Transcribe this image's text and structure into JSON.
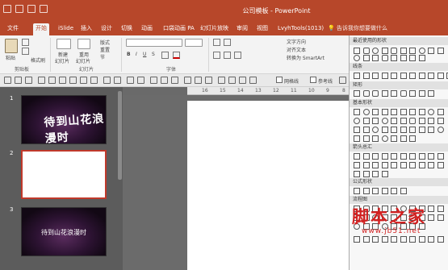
{
  "window": {
    "title": "公司模板 - PowerPoint"
  },
  "tabs": [
    {
      "label": "文件",
      "active": false
    },
    {
      "label": "开始",
      "active": true
    },
    {
      "label": "iSlide",
      "active": false
    },
    {
      "label": "插入",
      "active": false
    },
    {
      "label": "设计",
      "active": false
    },
    {
      "label": "切换",
      "active": false
    },
    {
      "label": "动画",
      "active": false
    },
    {
      "label": "口袋动画 PA",
      "active": false
    },
    {
      "label": "幻灯片放映",
      "active": false
    },
    {
      "label": "审阅",
      "active": false
    },
    {
      "label": "视图",
      "active": false
    },
    {
      "label": "LvyhTools(1013)",
      "active": false
    }
  ],
  "tell_me": "告诉我你想要做什么",
  "ribbon": {
    "paste": "粘贴",
    "format_painter": "格式刷",
    "new_slide": "新建",
    "new_slide2": "幻灯片",
    "reuse": "重用",
    "reuse2": "幻灯片",
    "layout": "版式",
    "reset": "重置",
    "section": "节",
    "text_direction": "文字方向",
    "align_text": "对齐文本",
    "smartart": "转换为 SmartArt",
    "groups": {
      "clipboard": "剪贴板",
      "slides": "幻灯片",
      "font": "字体"
    }
  },
  "toolbar2": {
    "gridlines": "网格线",
    "guides": "参考线"
  },
  "ruler_ticks": [
    "16",
    "15",
    "14",
    "13",
    "12",
    "11",
    "10",
    "9",
    "8"
  ],
  "slides": [
    {
      "num": "1",
      "text": "待到山花浪漫时"
    },
    {
      "num": "2",
      "text": ""
    },
    {
      "num": "3",
      "text": "待到山花浪漫时"
    }
  ],
  "gallery": {
    "categories": [
      "最近使用的形状",
      "线条",
      "矩形",
      "基本形状",
      "箭头总汇",
      "公式形状",
      "流程图"
    ]
  },
  "watermark": {
    "logo": "脚本之家",
    "url": "www.jb51.net"
  },
  "colors": {
    "accent": "#b7472a",
    "selection": "#c0392b"
  }
}
